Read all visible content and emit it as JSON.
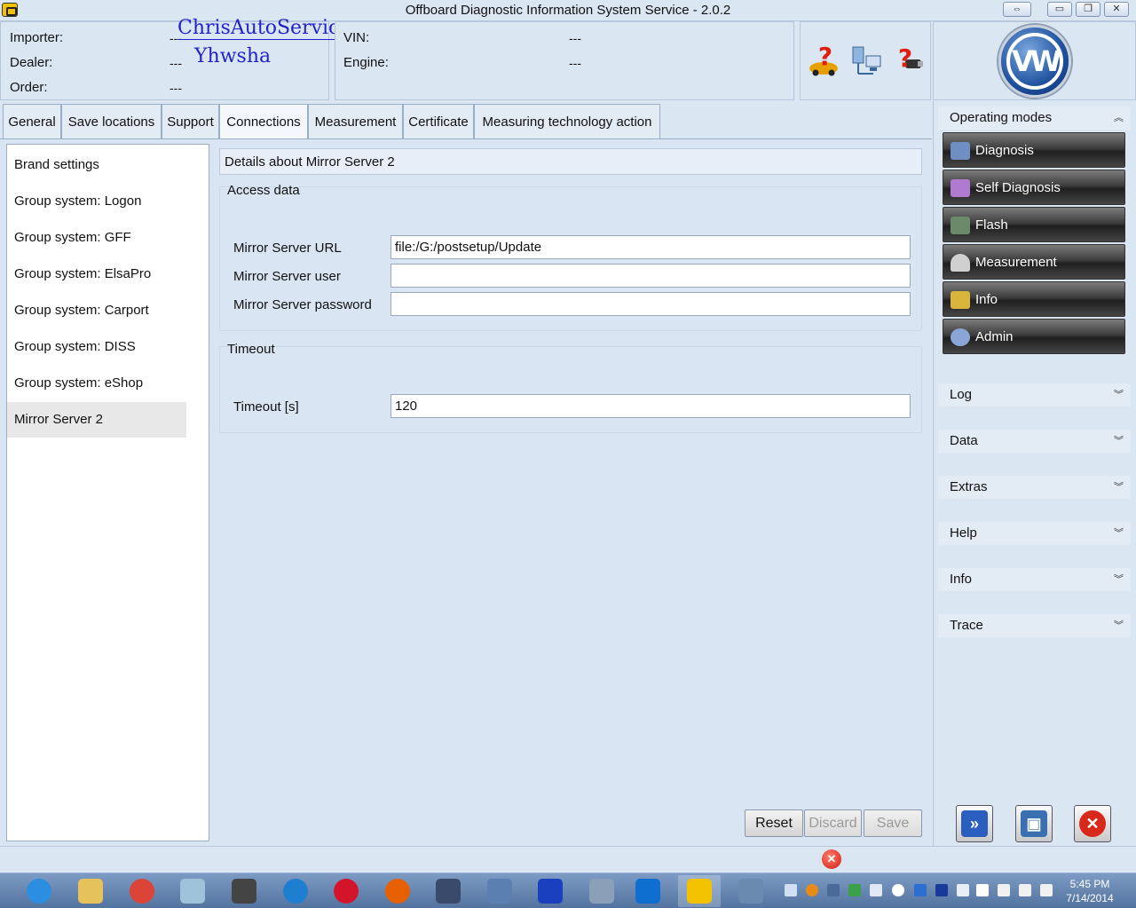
{
  "window": {
    "title": "Offboard Diagnostic Information System Service - 2.0.2",
    "controls": {
      "restore_label": "⇔",
      "minimize_label": "▭",
      "maximize_label": "❐",
      "close_label": "✕"
    }
  },
  "header": {
    "importer_label": "Importer:",
    "importer_value": "---",
    "dealer_label": "Dealer:",
    "dealer_value": "---",
    "order_label": "Order:",
    "order_value": "---",
    "vin_label": "VIN:",
    "vin_value": "---",
    "engine_label": "Engine:",
    "engine_value": "---",
    "watermark_line1": "ChrisAutoService",
    "watermark_line2": "Yhwsha",
    "help_icons": [
      "vehicle-help-icon",
      "network-help-icon",
      "plug-help-icon"
    ],
    "logo_text": "VW"
  },
  "tabs": [
    {
      "label": "General"
    },
    {
      "label": "Save locations"
    },
    {
      "label": "Support"
    },
    {
      "label": "Connections"
    },
    {
      "label": "Measurement"
    },
    {
      "label": "Certificate"
    },
    {
      "label": "Measuring technology action"
    }
  ],
  "active_tab": "Connections",
  "left_list": {
    "items": [
      {
        "label": "Brand settings"
      },
      {
        "label": "Group system: Logon"
      },
      {
        "label": "Group system: GFF"
      },
      {
        "label": "Group system: ElsaPro"
      },
      {
        "label": "Group system: Carport"
      },
      {
        "label": "Group system: DISS"
      },
      {
        "label": "Group system: eShop"
      },
      {
        "label": "Mirror Server 2"
      }
    ],
    "selected": "Mirror Server 2"
  },
  "detail": {
    "header": "Details about Mirror Server 2",
    "access_title": "Access data",
    "url_label": "Mirror Server URL",
    "url_value": "file:/G:/postsetup/Update",
    "user_label": "Mirror Server user",
    "user_value": "",
    "password_label": "Mirror Server password",
    "password_value": "",
    "timeout_title": "Timeout",
    "timeout_label": "Timeout [s]",
    "timeout_value": "120"
  },
  "actions": {
    "reset_label": "Reset",
    "discard_label": "Discard",
    "save_label": "Save"
  },
  "sidebar": {
    "operating_modes_label": "Operating modes",
    "modes": [
      {
        "label": "Diagnosis",
        "icon": "stethoscope-icon",
        "color": "#6f8fc4"
      },
      {
        "label": "Self Diagnosis",
        "icon": "self-diagnosis-icon",
        "color": "#b07ad0"
      },
      {
        "label": "Flash",
        "icon": "flash-chip-icon",
        "color": "#6a8a6a"
      },
      {
        "label": "Measurement",
        "icon": "gauge-icon",
        "color": "#d0d0d0"
      },
      {
        "label": "Info",
        "icon": "books-icon",
        "color": "#d8b43a"
      },
      {
        "label": "Admin",
        "icon": "gear-icon",
        "color": "#8aa6d6"
      }
    ],
    "sections": [
      {
        "label": "Log"
      },
      {
        "label": "Data"
      },
      {
        "label": "Extras"
      },
      {
        "label": "Help"
      },
      {
        "label": "Info"
      },
      {
        "label": "Trace"
      }
    ],
    "bottom_buttons": [
      {
        "icon": "forward-icon",
        "glyph": "»",
        "color": "#2a5fbf"
      },
      {
        "icon": "fit-window-icon",
        "glyph": "▣",
        "color": "#3a6fb0"
      },
      {
        "icon": "close-app-icon",
        "glyph": "✕",
        "color": "#d8281a"
      }
    ]
  },
  "statusbar": {
    "error_glyph": "✕"
  },
  "taskbar": {
    "apps": [
      {
        "icon": "internet-explorer-icon",
        "color": "#2b8ee0"
      },
      {
        "icon": "file-explorer-icon",
        "color": "#e6c25a"
      },
      {
        "icon": "chrome-icon",
        "color": "#db4437"
      },
      {
        "icon": "notes-icon",
        "color": "#9ec3d8"
      },
      {
        "icon": "keyboard-app-icon",
        "color": "#444444"
      },
      {
        "icon": "ie-update-icon",
        "color": "#1e7fd0"
      },
      {
        "icon": "opera-icon",
        "color": "#d4142a"
      },
      {
        "icon": "firefox-icon",
        "color": "#e66000"
      },
      {
        "icon": "media-app-icon",
        "color": "#3a4a6a"
      },
      {
        "icon": "computer-icon",
        "color": "#5a7fb0"
      },
      {
        "icon": "connector-icon",
        "color": "#1a3fbf"
      },
      {
        "icon": "monitor-app-icon",
        "color": "#8aa0b8"
      },
      {
        "icon": "teamviewer-icon",
        "color": "#0e6fd0"
      },
      {
        "icon": "odis-app-icon",
        "color": "#f2c200"
      },
      {
        "icon": "remote-app-icon",
        "color": "#6a8ab0"
      }
    ],
    "clock_time": "5:45 PM",
    "clock_date": "7/14/2014"
  }
}
